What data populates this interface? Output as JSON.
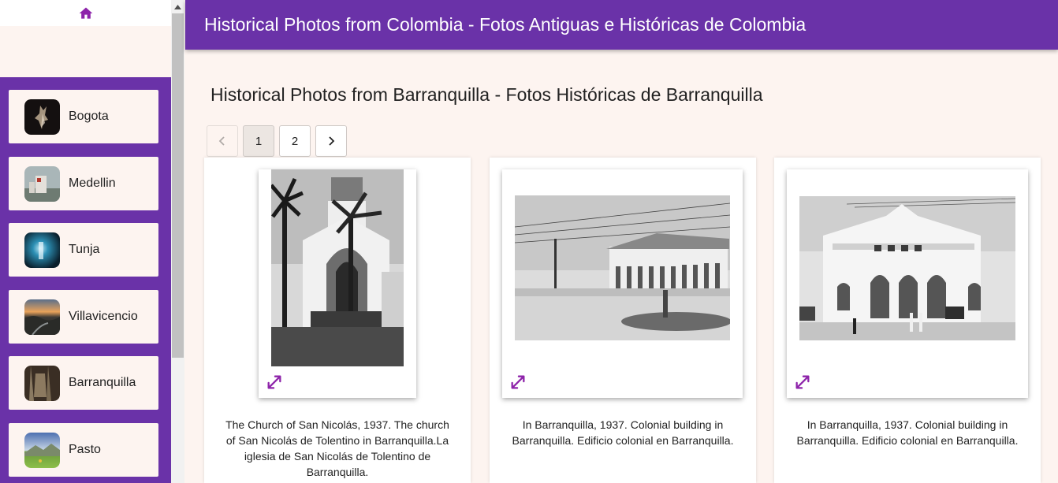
{
  "header": {
    "title": "Historical Photos from Colombia - Fotos Antiguas e Históricas de Colombia"
  },
  "page": {
    "title": "Historical Photos from Barranquilla - Fotos Históricas de Barranquilla"
  },
  "sidebar": {
    "home_icon": "home-icon",
    "items": [
      {
        "label": "Bogota"
      },
      {
        "label": "Medellin"
      },
      {
        "label": "Tunja"
      },
      {
        "label": "Villavicencio"
      },
      {
        "label": "Barranquilla"
      },
      {
        "label": "Pasto"
      }
    ]
  },
  "pagination": {
    "pages": [
      "1",
      "2"
    ],
    "current": "1"
  },
  "cards": [
    {
      "caption": "The Church of San Nicolás, 1937. The church of San Nicolás de Tolentino in Barranquilla.La iglesia de San Nicolás de Tolentino de Barranquilla."
    },
    {
      "caption": "In Barranquilla, 1937. Colonial building in Barranquilla. Edificio colonial en Barranquilla."
    },
    {
      "caption": "In Barranquilla, 1937. Colonial building in Barranquilla. Edificio colonial en Barranquilla."
    }
  ],
  "colors": {
    "primary": "#6a32a8",
    "background": "#fdf4f0",
    "icon_accent": "#8e24aa"
  }
}
